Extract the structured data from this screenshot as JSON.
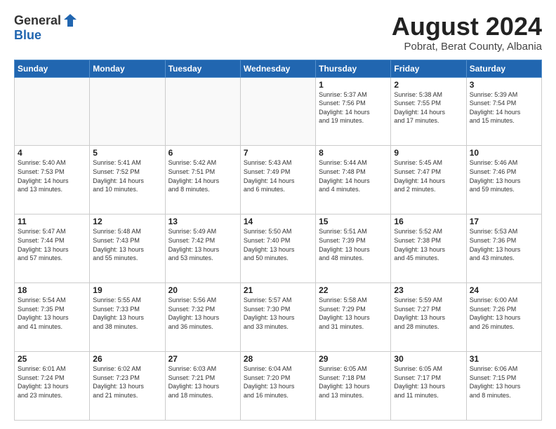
{
  "header": {
    "logo_general": "General",
    "logo_blue": "Blue",
    "month_title": "August 2024",
    "subtitle": "Pobrat, Berat County, Albania"
  },
  "weekdays": [
    "Sunday",
    "Monday",
    "Tuesday",
    "Wednesday",
    "Thursday",
    "Friday",
    "Saturday"
  ],
  "weeks": [
    [
      {
        "day": "",
        "info": ""
      },
      {
        "day": "",
        "info": ""
      },
      {
        "day": "",
        "info": ""
      },
      {
        "day": "",
        "info": ""
      },
      {
        "day": "1",
        "info": "Sunrise: 5:37 AM\nSunset: 7:56 PM\nDaylight: 14 hours\nand 19 minutes."
      },
      {
        "day": "2",
        "info": "Sunrise: 5:38 AM\nSunset: 7:55 PM\nDaylight: 14 hours\nand 17 minutes."
      },
      {
        "day": "3",
        "info": "Sunrise: 5:39 AM\nSunset: 7:54 PM\nDaylight: 14 hours\nand 15 minutes."
      }
    ],
    [
      {
        "day": "4",
        "info": "Sunrise: 5:40 AM\nSunset: 7:53 PM\nDaylight: 14 hours\nand 13 minutes."
      },
      {
        "day": "5",
        "info": "Sunrise: 5:41 AM\nSunset: 7:52 PM\nDaylight: 14 hours\nand 10 minutes."
      },
      {
        "day": "6",
        "info": "Sunrise: 5:42 AM\nSunset: 7:51 PM\nDaylight: 14 hours\nand 8 minutes."
      },
      {
        "day": "7",
        "info": "Sunrise: 5:43 AM\nSunset: 7:49 PM\nDaylight: 14 hours\nand 6 minutes."
      },
      {
        "day": "8",
        "info": "Sunrise: 5:44 AM\nSunset: 7:48 PM\nDaylight: 14 hours\nand 4 minutes."
      },
      {
        "day": "9",
        "info": "Sunrise: 5:45 AM\nSunset: 7:47 PM\nDaylight: 14 hours\nand 2 minutes."
      },
      {
        "day": "10",
        "info": "Sunrise: 5:46 AM\nSunset: 7:46 PM\nDaylight: 13 hours\nand 59 minutes."
      }
    ],
    [
      {
        "day": "11",
        "info": "Sunrise: 5:47 AM\nSunset: 7:44 PM\nDaylight: 13 hours\nand 57 minutes."
      },
      {
        "day": "12",
        "info": "Sunrise: 5:48 AM\nSunset: 7:43 PM\nDaylight: 13 hours\nand 55 minutes."
      },
      {
        "day": "13",
        "info": "Sunrise: 5:49 AM\nSunset: 7:42 PM\nDaylight: 13 hours\nand 53 minutes."
      },
      {
        "day": "14",
        "info": "Sunrise: 5:50 AM\nSunset: 7:40 PM\nDaylight: 13 hours\nand 50 minutes."
      },
      {
        "day": "15",
        "info": "Sunrise: 5:51 AM\nSunset: 7:39 PM\nDaylight: 13 hours\nand 48 minutes."
      },
      {
        "day": "16",
        "info": "Sunrise: 5:52 AM\nSunset: 7:38 PM\nDaylight: 13 hours\nand 45 minutes."
      },
      {
        "day": "17",
        "info": "Sunrise: 5:53 AM\nSunset: 7:36 PM\nDaylight: 13 hours\nand 43 minutes."
      }
    ],
    [
      {
        "day": "18",
        "info": "Sunrise: 5:54 AM\nSunset: 7:35 PM\nDaylight: 13 hours\nand 41 minutes."
      },
      {
        "day": "19",
        "info": "Sunrise: 5:55 AM\nSunset: 7:33 PM\nDaylight: 13 hours\nand 38 minutes."
      },
      {
        "day": "20",
        "info": "Sunrise: 5:56 AM\nSunset: 7:32 PM\nDaylight: 13 hours\nand 36 minutes."
      },
      {
        "day": "21",
        "info": "Sunrise: 5:57 AM\nSunset: 7:30 PM\nDaylight: 13 hours\nand 33 minutes."
      },
      {
        "day": "22",
        "info": "Sunrise: 5:58 AM\nSunset: 7:29 PM\nDaylight: 13 hours\nand 31 minutes."
      },
      {
        "day": "23",
        "info": "Sunrise: 5:59 AM\nSunset: 7:27 PM\nDaylight: 13 hours\nand 28 minutes."
      },
      {
        "day": "24",
        "info": "Sunrise: 6:00 AM\nSunset: 7:26 PM\nDaylight: 13 hours\nand 26 minutes."
      }
    ],
    [
      {
        "day": "25",
        "info": "Sunrise: 6:01 AM\nSunset: 7:24 PM\nDaylight: 13 hours\nand 23 minutes."
      },
      {
        "day": "26",
        "info": "Sunrise: 6:02 AM\nSunset: 7:23 PM\nDaylight: 13 hours\nand 21 minutes."
      },
      {
        "day": "27",
        "info": "Sunrise: 6:03 AM\nSunset: 7:21 PM\nDaylight: 13 hours\nand 18 minutes."
      },
      {
        "day": "28",
        "info": "Sunrise: 6:04 AM\nSunset: 7:20 PM\nDaylight: 13 hours\nand 16 minutes."
      },
      {
        "day": "29",
        "info": "Sunrise: 6:05 AM\nSunset: 7:18 PM\nDaylight: 13 hours\nand 13 minutes."
      },
      {
        "day": "30",
        "info": "Sunrise: 6:05 AM\nSunset: 7:17 PM\nDaylight: 13 hours\nand 11 minutes."
      },
      {
        "day": "31",
        "info": "Sunrise: 6:06 AM\nSunset: 7:15 PM\nDaylight: 13 hours\nand 8 minutes."
      }
    ]
  ]
}
